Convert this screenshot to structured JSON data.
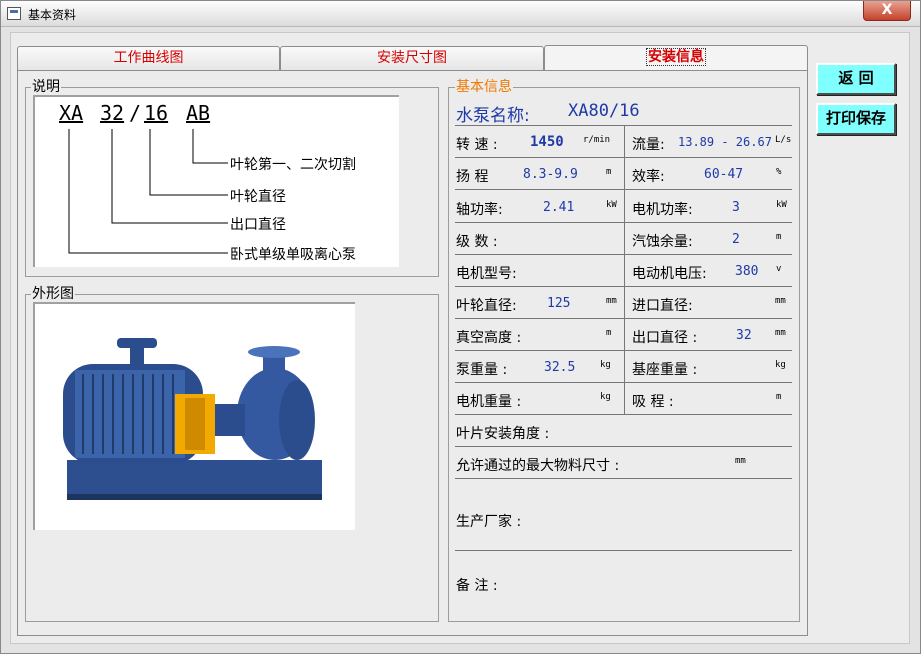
{
  "window": {
    "title": "基本资料",
    "close_label": "X"
  },
  "tabs": [
    {
      "label": "工作曲线图"
    },
    {
      "label": "安装尺寸图"
    },
    {
      "label": "安装信息"
    }
  ],
  "explanation": {
    "legend": "说明",
    "code": {
      "part1": "XA",
      "part2": "32",
      "slash": "/",
      "part3": "16",
      "part4": "AB"
    },
    "notes": [
      "叶轮第一、二次切割",
      "叶轮直径",
      "出口直径",
      "卧式单级单吸离心泵"
    ]
  },
  "outline": {
    "legend": "外形图"
  },
  "info": {
    "legend": "基本信息",
    "pump_name_label": "水泵名称:",
    "pump_name_value": "XA80/16",
    "rows": [
      {
        "left": {
          "label": "转 速 :",
          "value": "1450",
          "unit": "r/min"
        },
        "right": {
          "label": "流量:",
          "value": "13.89 - 26.67",
          "unit": "L/s"
        }
      },
      {
        "left": {
          "label": "扬 程",
          "value": "8.3-9.9",
          "unit": "m"
        },
        "right": {
          "label": "效率:",
          "value": "60-47",
          "unit": "%"
        }
      },
      {
        "left": {
          "label": "轴功率:",
          "value": "2.41",
          "unit": "kW"
        },
        "right": {
          "label": "电机功率:",
          "value": "3",
          "unit": "kW"
        }
      },
      {
        "left": {
          "label": "级 数 :",
          "value": "",
          "unit": ""
        },
        "right": {
          "label": "汽蚀余量:",
          "value": "2",
          "unit": "m"
        }
      },
      {
        "left": {
          "label": "电机型号:",
          "value": "",
          "unit": ""
        },
        "right": {
          "label": "电动机电压:",
          "value": "380",
          "unit": "v"
        }
      },
      {
        "left": {
          "label": "叶轮直径:",
          "value": "125",
          "unit": "mm"
        },
        "right": {
          "label": "进口直径:",
          "value": "",
          "unit": "mm"
        }
      },
      {
        "left": {
          "label": "真空高度 :",
          "value": "",
          "unit": "m"
        },
        "right": {
          "label": "出口直径 :",
          "value": "32",
          "unit": "mm"
        }
      },
      {
        "left": {
          "label": "泵重量 :",
          "value": "32.5",
          "unit": "kg"
        },
        "right": {
          "label": "基座重量 :",
          "value": "",
          "unit": "kg"
        }
      },
      {
        "left": {
          "label": "电机重量 :",
          "value": "",
          "unit": "kg"
        },
        "right": {
          "label": "吸 程 :",
          "value": "",
          "unit": "m"
        }
      }
    ],
    "blade_angle_label": "叶片安装角度 :",
    "max_particle_label": "允许通过的最大物料尺寸 :",
    "max_particle_unit": "mm",
    "manufacturer_label": "生产厂家 :",
    "remarks_label": "备 注 :"
  },
  "buttons": {
    "back": "返 回",
    "print_save": "打印保存"
  },
  "colors": {
    "tab_text": "#d60000",
    "info_legend": "#f07800",
    "value": "#1e3aa8",
    "button_bg": "#80ffff"
  }
}
